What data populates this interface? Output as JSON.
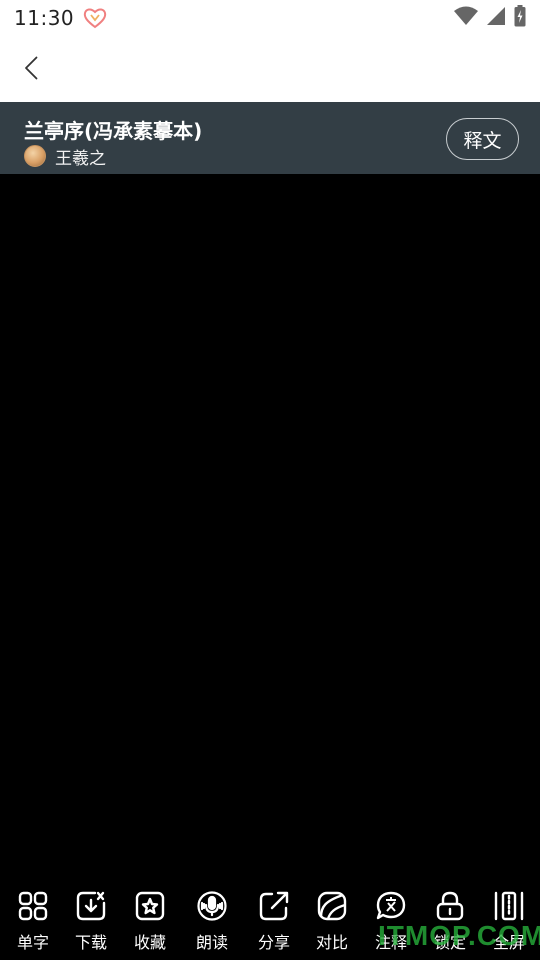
{
  "status_bar": {
    "time": "11:30",
    "icons": [
      "notification-icon",
      "wifi-icon",
      "signal-icon",
      "battery-icon"
    ]
  },
  "nav": {
    "back_icon": "chevron-left-icon"
  },
  "header": {
    "title": "兰亭序(冯承素摹本)",
    "author": "王羲之",
    "shiwen_label": "释文",
    "background_color": "#333e45"
  },
  "toolbar": {
    "items": [
      {
        "label": "单字",
        "icon": "grid-icon"
      },
      {
        "label": "下载",
        "icon": "download-icon"
      },
      {
        "label": "收藏",
        "icon": "star-icon"
      },
      {
        "label": "朗读",
        "icon": "microphone-icon"
      },
      {
        "label": "分享",
        "icon": "share-icon"
      },
      {
        "label": "对比",
        "icon": "compare-icon"
      },
      {
        "label": "注释",
        "icon": "annotation-icon"
      },
      {
        "label": "锁定",
        "icon": "lock-icon"
      },
      {
        "label": "全屏",
        "icon": "fullscreen-icon"
      }
    ]
  },
  "watermark": "ITMOP.COM",
  "colors": {
    "accent_white": "#ffffff",
    "canvas": "#000000"
  }
}
